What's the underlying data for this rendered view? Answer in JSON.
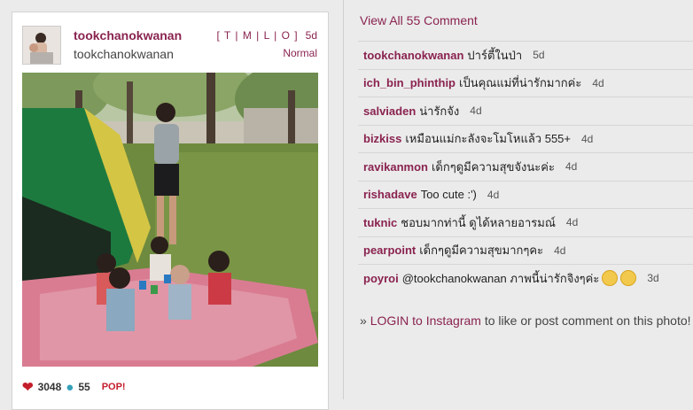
{
  "post": {
    "username": "tookchanokwanan",
    "handle": "tookchanokwanan",
    "views": "[ T | M | L | O ]",
    "age": "5d",
    "filter": "Normal",
    "likes": "3048",
    "comments_count": "55",
    "pop": "POP!"
  },
  "comments_panel": {
    "view_all": "View All 55 Comment",
    "items": [
      {
        "user": "tookchanokwanan",
        "text": "ปาร์ตี้ในป่า",
        "age": "5d"
      },
      {
        "user": "ich_bin_phinthip",
        "text": "เป็นคุณแม่ที่น่ารักมากค่ะ",
        "age": "4d"
      },
      {
        "user": "salviaden",
        "text": "น่ารักจัง",
        "age": "4d"
      },
      {
        "user": "bizkiss",
        "text": "เหมือนแม่กะลังจะโมโหแล้ว 555+",
        "age": "4d"
      },
      {
        "user": "ravikanmon",
        "text": "เด็กๆดูมีความสุขจังนะค่ะ",
        "age": "4d"
      },
      {
        "user": "rishadave",
        "text": "Too cute :')",
        "age": "4d"
      },
      {
        "user": "tuknic",
        "text": "ชอบมากท่านี้ ดูได้หลายอารมณ์",
        "age": "4d"
      },
      {
        "user": "pearpoint",
        "text": "เด็กๆดูมีความสุขมากๆคะ",
        "age": "4d"
      },
      {
        "user": "poyroi",
        "text": "@tookchanokwanan ภาพนี้น่ารักจิงๆค่ะ",
        "age": "3d"
      }
    ],
    "login_prefix": "» ",
    "login_link": "LOGIN to Instagram",
    "login_suffix": " to like or post comment on this photo!"
  },
  "icons": {
    "likes": "heart-icon",
    "comments": "speech-bubble-icon",
    "emoji": "smirk-emoji-icon"
  },
  "colors": {
    "accent": "#8a2350",
    "heart": "#c41e2b",
    "bubble": "#35a0b9",
    "background": "#ebebeb"
  }
}
